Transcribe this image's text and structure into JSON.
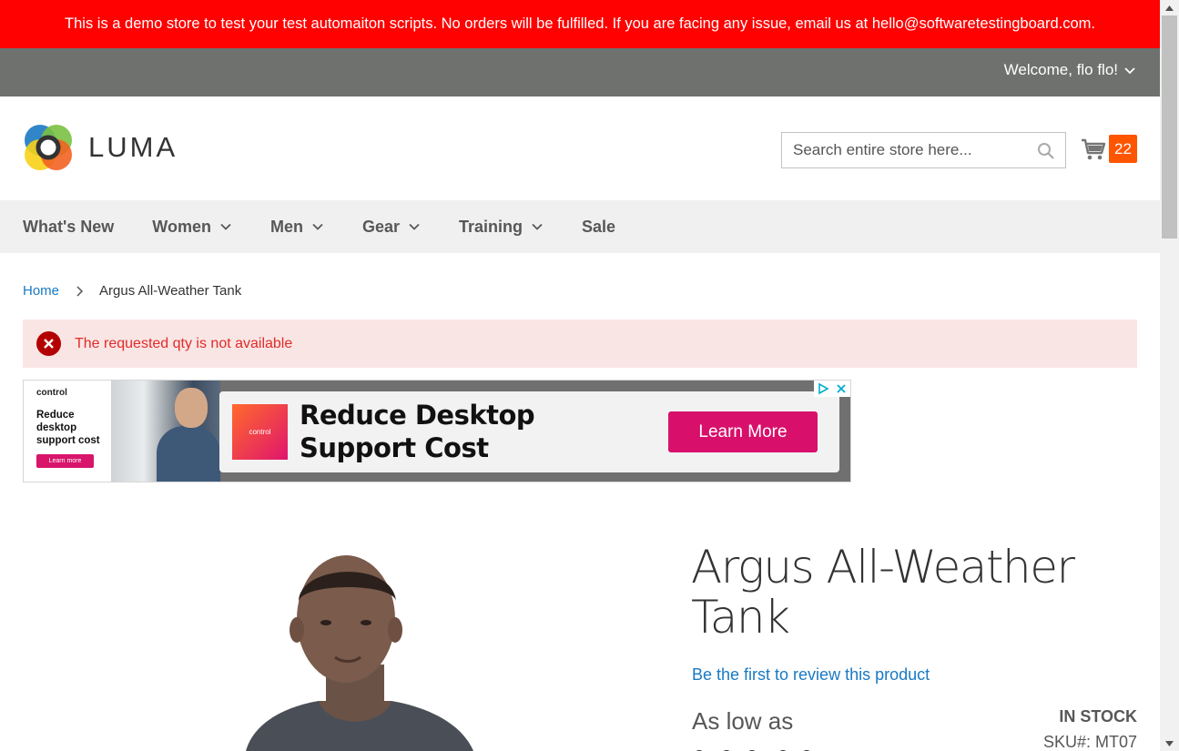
{
  "demo_banner": "This is a demo store to test your test automaiton scripts. No orders will be fulfilled. If you are facing any issue, email us at hello@softwaretestingboard.com.",
  "header": {
    "welcome": "Welcome, flo flo!",
    "logo_text": "LUMA",
    "search_placeholder": "Search entire store here...",
    "cart_count": "22"
  },
  "nav": {
    "items": [
      {
        "label": "What's New"
      },
      {
        "label": "Women"
      },
      {
        "label": "Men"
      },
      {
        "label": "Gear"
      },
      {
        "label": "Training"
      },
      {
        "label": "Sale"
      }
    ]
  },
  "breadcrumb": {
    "home": "Home",
    "current": "Argus All-Weather Tank"
  },
  "error_message": "The requested qty is not available",
  "ad": {
    "brand": "control",
    "small_text": "Reduce desktop support cost",
    "small_button": "Learn more",
    "headline": "Reduce Desktop Support Cost",
    "cta": "Learn More"
  },
  "product": {
    "title": "Argus All-Weather Tank",
    "review_link": "Be the first to review this product",
    "as_low_as": "As low as",
    "stock": "IN STOCK",
    "sku_label": "SKU#:",
    "sku_value": "MT07"
  },
  "colors": {
    "demo_banner_bg": "#ff0101",
    "top_bar_bg": "#6e716e",
    "link": "#1979c3",
    "cart_badge": "#ff5501",
    "error_bg": "#fae5e5",
    "error_text": "#e02b27",
    "ad_cta": "#d8106b"
  }
}
